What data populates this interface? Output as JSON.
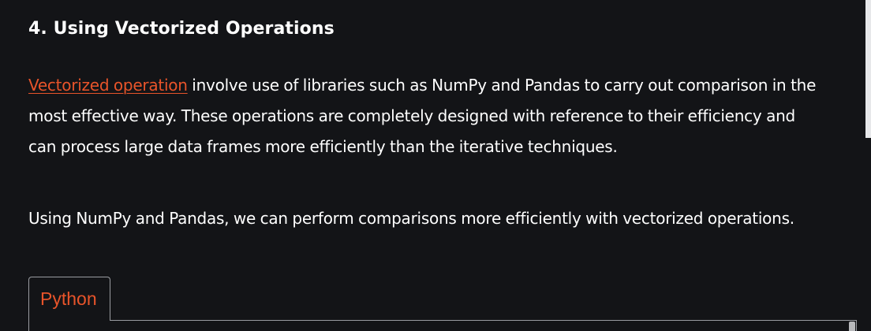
{
  "article": {
    "heading": "4. Using Vectorized Operations",
    "paragraph1": {
      "link_text": "Vectorized operation",
      "text": " involve use of libraries such as NumPy and Pandas to carry out comparison in the most effective way. These operations are completely designed with reference to their efficiency and can process large data frames more efficiently than the iterative techniques."
    },
    "paragraph2": "Using NumPy and Pandas, we can perform comparisons more efficiently with vectorized operations."
  },
  "code_block": {
    "tab_label": "Python"
  },
  "colors": {
    "background": "#131417",
    "text": "#ffffff",
    "accent": "#e8542a",
    "border": "#9a9ca1"
  }
}
